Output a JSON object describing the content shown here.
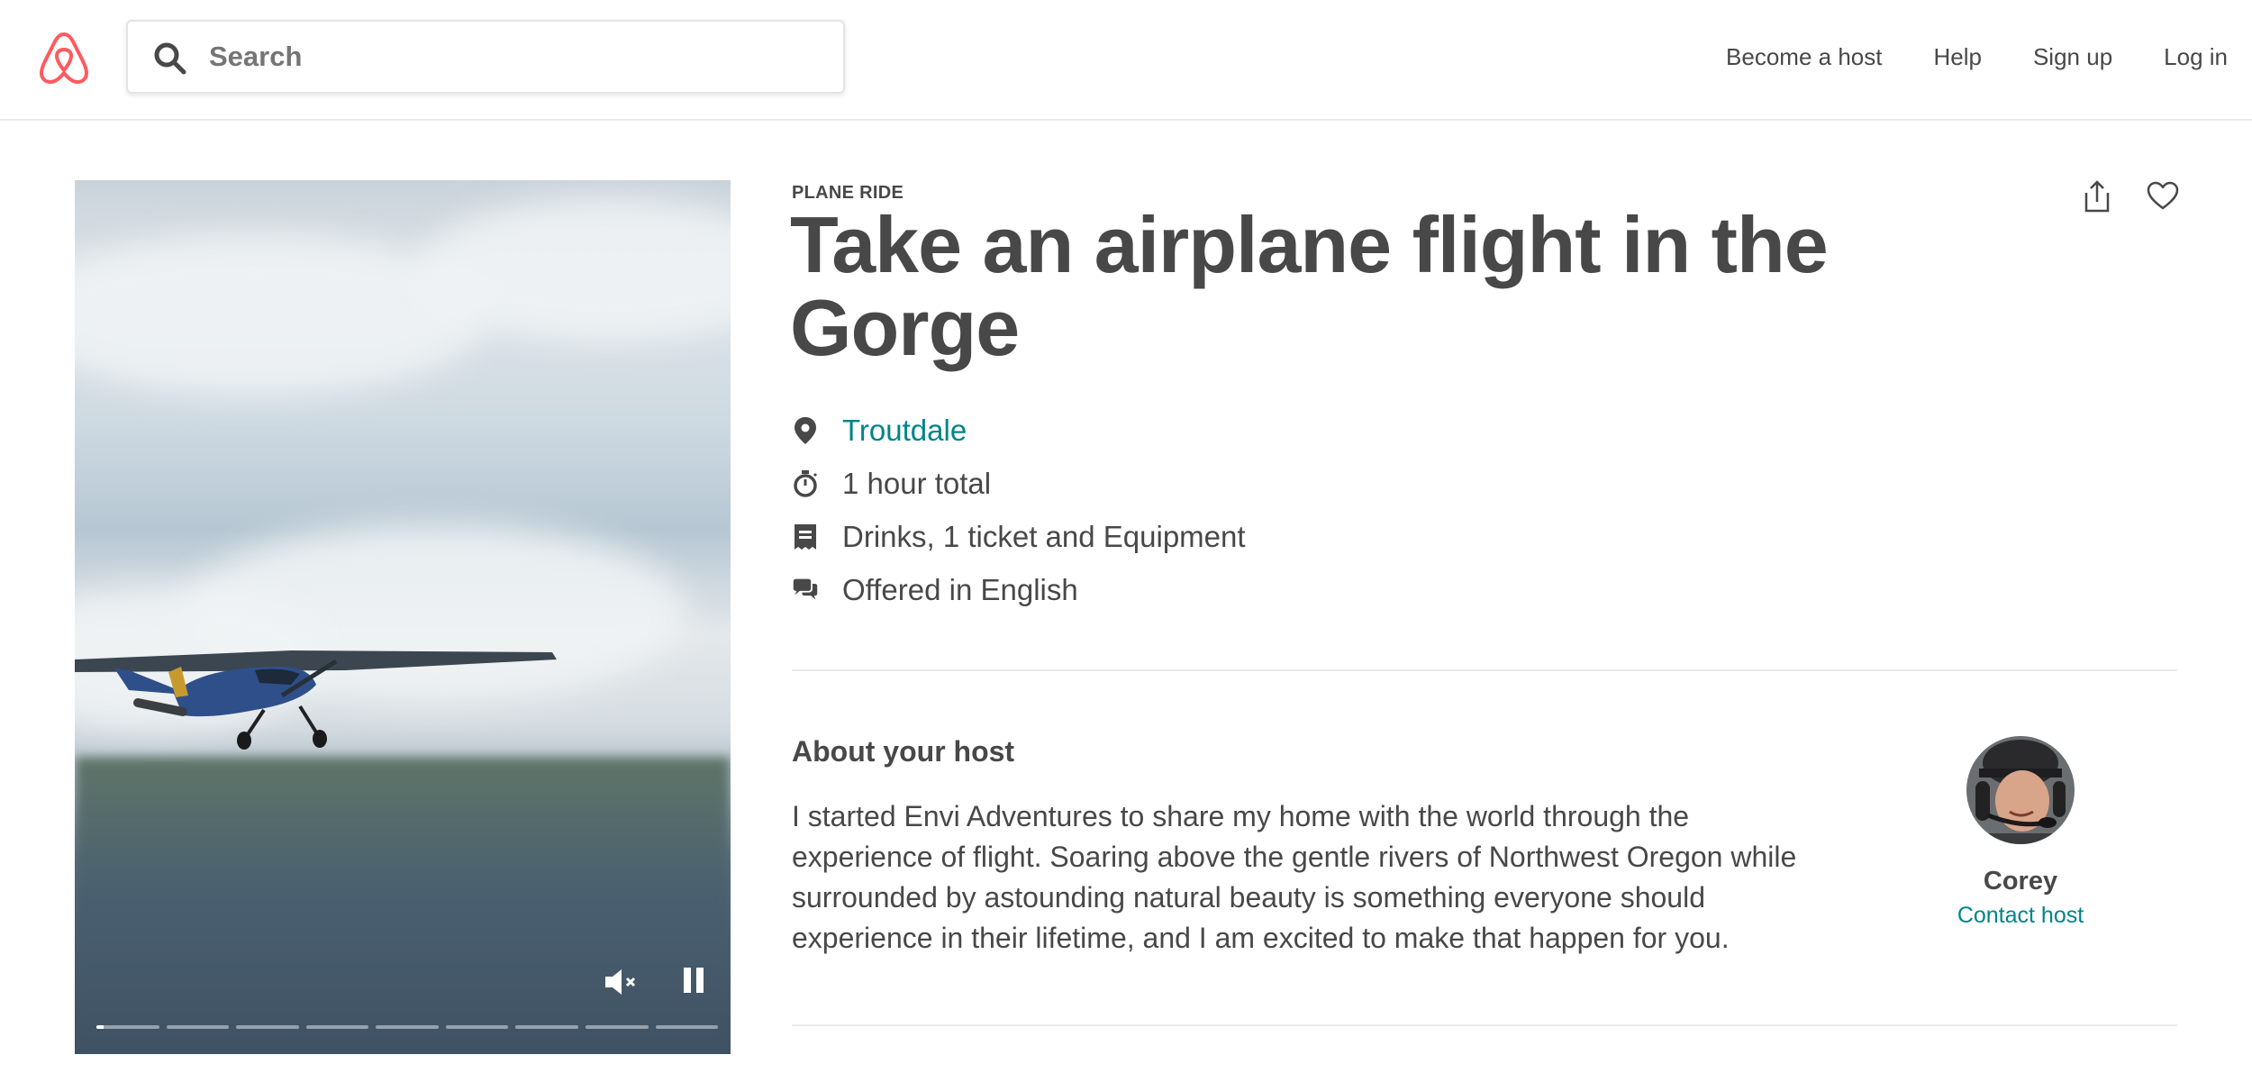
{
  "header": {
    "logo": "airbnb-logo",
    "search": {
      "placeholder": "Search",
      "value": ""
    },
    "nav": {
      "become_host": "Become a host",
      "help": "Help",
      "sign_up": "Sign up",
      "log_in": "Log in"
    }
  },
  "video": {
    "segments": 9,
    "current_segment": 1,
    "current_segment_progress": 0.12,
    "muted": true,
    "playing": true
  },
  "experience": {
    "category": "PLANE RIDE",
    "title": "Take an airplane flight in the Gorge",
    "facts": [
      {
        "icon": "location-pin-icon",
        "text": "Troutdale",
        "is_link": true
      },
      {
        "icon": "stopwatch-icon",
        "text": "1 hour total",
        "is_link": false
      },
      {
        "icon": "receipt-icon",
        "text": "Drinks, 1 ticket and Equipment",
        "is_link": false
      },
      {
        "icon": "chat-bubbles-icon",
        "text": "Offered in English",
        "is_link": false
      }
    ]
  },
  "host": {
    "heading": "About your host",
    "bio": "I started Envi Adventures to share my home with the world through the experience of flight. Soaring above the gentle rivers of Northwest Oregon while surrounded by astounding natural beauty is something everyone should experience in their lifetime, and I am excited to make that happen for you.",
    "name": "Corey",
    "contact_label": "Contact host"
  },
  "colors": {
    "text": "#484848",
    "link": "#008489",
    "brand": "#FF5A5F",
    "divider": "#EBEBEB"
  }
}
